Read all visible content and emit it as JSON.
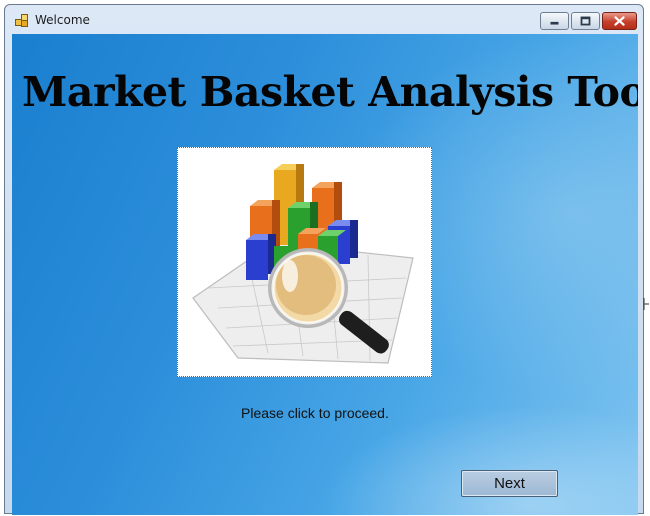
{
  "window": {
    "title": "Welcome",
    "icon": "application-icon",
    "controls": [
      "minimize-icon",
      "maximize-icon",
      "close-icon"
    ]
  },
  "main": {
    "heading": "Market Basket Analysis Tool",
    "image": "3d-bar-chart-with-magnifying-glass",
    "prompt": "Please click to proceed.",
    "next_label": "Next"
  },
  "colors": {
    "background_blue": "#2d8fdb",
    "heading_text": "#050505",
    "button_face": "#a9c2db",
    "close_button": "#c63f2b"
  }
}
